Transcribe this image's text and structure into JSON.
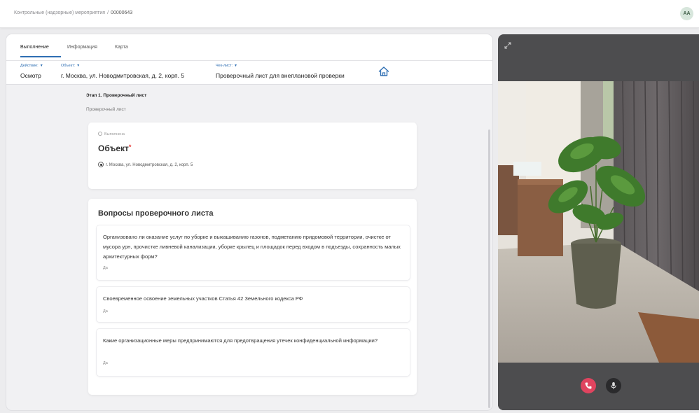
{
  "breadcrumb": {
    "parent": "Контрольные (надзорные) мероприятия",
    "separator": "/",
    "current": "00000643"
  },
  "user": {
    "initials": "AA"
  },
  "tabs": [
    {
      "label": "Выполнение",
      "active": true
    },
    {
      "label": "Информация",
      "active": false
    },
    {
      "label": "Карта",
      "active": false
    }
  ],
  "filters": {
    "action": {
      "label": "Действие:",
      "value": "Осмотр"
    },
    "object": {
      "label": "Объект:",
      "value": "г. Москва, ул. Новодмитровская, д. 2, корп. 5"
    },
    "checklist": {
      "label": "Чек-лист:",
      "value": "Проверочный лист для внеплановой проверки"
    }
  },
  "stage": {
    "title": "Этап 1. Проверочный лист",
    "subtitle": "Проверочный лист"
  },
  "object_card": {
    "status": "Выполнена",
    "title": "Объект",
    "required_mark": "*",
    "selected_address": "г. Москва, ул. Новодмитровская, д. 2, корп. 5"
  },
  "questions": {
    "title": "Вопросы проверочного листа",
    "items": [
      {
        "text": "Организовано ли оказание услуг по уборке и выкашиванию газонов, подметанию придомовой территории, очистке от мусора урн, прочистке ливневой канализации, уборке крылец и площадок перед входом в подъезды, сохранность малых архитектурных форм?",
        "answer": "Да"
      },
      {
        "text": "Своевременное освоение земельных участков Статья 42 Земельного кодекса РФ",
        "answer": "Да"
      },
      {
        "text": "Какие организационные меры предпринимаются для предотвращения утечек конфиденциальной информации?",
        "answer": "Да"
      }
    ]
  },
  "icons": {
    "caret": "▼",
    "home": "home-icon",
    "expand": "expand-icon",
    "call": "phone-icon",
    "mic": "microphone-icon"
  },
  "colors": {
    "accent": "#2f6fb3",
    "required": "#e53935",
    "call_button": "#e0445f",
    "video_panel": "#4d4d4f"
  }
}
